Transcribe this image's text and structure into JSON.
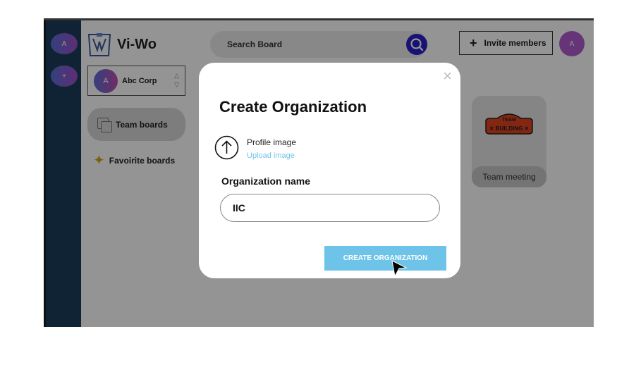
{
  "rail": {
    "avatar_letter": "A",
    "add_symbol": "+"
  },
  "brand": {
    "name": "Vi-Wo",
    "logo_icon": "vi-wo-logo"
  },
  "org_switcher": {
    "avatar_letter": "A",
    "name": "Abc Corp"
  },
  "sidebar": {
    "items": [
      {
        "label": "Team boards",
        "icon": "boards-icon"
      },
      {
        "label": "Favoirite boards",
        "icon": "sparkle-icon"
      }
    ]
  },
  "search": {
    "placeholder": "Search Board",
    "icon": "search-icon"
  },
  "header": {
    "invite_label": "Invite members",
    "user_avatar_letter": "A"
  },
  "boards": [
    {
      "title": "Team meeting",
      "badge_text": "TEAM BUILDING"
    }
  ],
  "modal": {
    "title": "Create Organization",
    "close_symbol": "×",
    "profile_image_label": "Profile image",
    "upload_link": "Upload image",
    "name_label": "Organization name",
    "name_value": "IIC",
    "submit_label": "CREATE ORGANIZATION"
  },
  "colors": {
    "rail": "#1a3d5c",
    "accent_button": "#6ec4e8",
    "search_button": "#2a1fc8",
    "user_avatar": "#b05ccf",
    "badge": "#e2441f"
  }
}
